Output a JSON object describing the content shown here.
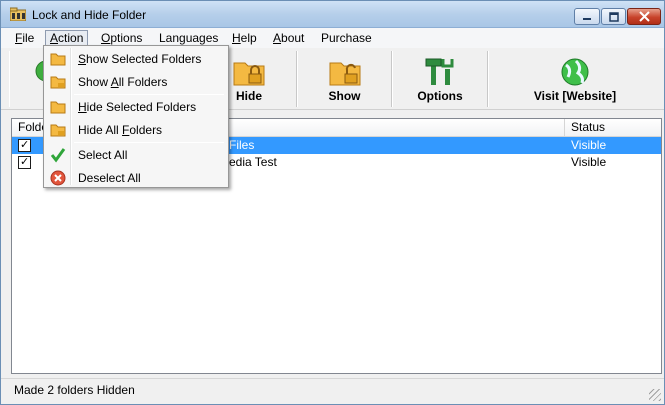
{
  "window": {
    "title": "Lock and Hide Folder"
  },
  "menubar": {
    "items": [
      {
        "label": "File",
        "u": "F",
        "rest": "ile"
      },
      {
        "label": "Action",
        "u": "A",
        "rest": "ction"
      },
      {
        "label": "Options",
        "u": "O",
        "rest": "ptions"
      },
      {
        "label": "Languages",
        "u": "",
        "rest": "Languages"
      },
      {
        "label": "Help",
        "u": "H",
        "rest": "elp"
      },
      {
        "label": "About",
        "u": "A",
        "rest": "bout"
      },
      {
        "label": "Purchase",
        "u": "",
        "rest": "Purchase"
      }
    ]
  },
  "toolbar": {
    "hide_label": "Hide",
    "show_label": "Show",
    "options_label": "Options",
    "visit_label": "Visit [Website]"
  },
  "list": {
    "columns": [
      "Folder",
      "Status"
    ],
    "rows": [
      {
        "name": "Files",
        "status": "Visible",
        "checked": true,
        "selected": true
      },
      {
        "name": "edia Test",
        "status": "Visible",
        "checked": true,
        "selected": false
      }
    ]
  },
  "action_menu": {
    "show_selected": {
      "pre": "",
      "u": "S",
      "post": "how Selected Folders"
    },
    "show_all": {
      "pre": "Show ",
      "u": "A",
      "post": "ll Folders"
    },
    "hide_selected": {
      "pre": "",
      "u": "H",
      "post": "ide Selected Folders"
    },
    "hide_all": {
      "pre": "Hide All ",
      "u": "F",
      "post": "olders"
    },
    "select_all": "Select All",
    "deselect_all": "Deselect All"
  },
  "status": {
    "text": "Made  2  folders Hidden"
  },
  "colors": {
    "selection": "#3399ff",
    "folder": "#f4b942",
    "lock": "#e0a020"
  }
}
